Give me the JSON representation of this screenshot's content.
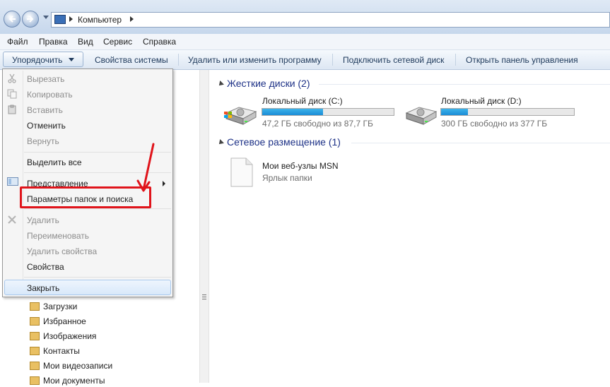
{
  "address": {
    "crumbs": [
      "Компьютер"
    ]
  },
  "menubar": {
    "items": [
      "Файл",
      "Правка",
      "Вид",
      "Сервис",
      "Справка"
    ]
  },
  "command_bar": {
    "organize": "Упорядочить",
    "system_properties": "Свойства системы",
    "uninstall": "Удалить или изменить программу",
    "map_drive": "Подключить сетевой диск",
    "control_panel": "Открыть панель управления"
  },
  "context_menu": {
    "cut": "Вырезать",
    "copy": "Копировать",
    "paste": "Вставить",
    "undo": "Отменить",
    "redo": "Вернуть",
    "select_all": "Выделить все",
    "layout": "Представление",
    "folder_options": "Параметры папок и поиска",
    "delete": "Удалить",
    "rename": "Переименовать",
    "remove_properties": "Удалить свойства",
    "properties": "Свойства",
    "close": "Закрыть"
  },
  "navigation": {
    "items": [
      "Загрузки",
      "Избранное",
      "Изображения",
      "Контакты",
      "Мои видеозаписи",
      "Мои документы"
    ]
  },
  "hard_drives": {
    "header": "Жесткие диски (2)",
    "drives": [
      {
        "name": "Локальный диск (C:)",
        "info": "47,2 ГБ свободно из 87,7 ГБ",
        "used_fraction": 0.46
      },
      {
        "name": "Локальный диск (D:)",
        "info": "300 ГБ свободно из 377 ГБ",
        "used_fraction": 0.2
      }
    ]
  },
  "network": {
    "header": "Сетевое размещение (1)",
    "item_name": "Мои веб-узлы MSN",
    "item_type": "Ярлык папки"
  },
  "colors": {
    "highlight_box": "#e0141b",
    "drive_fill": "#1a8cd6",
    "group_header": "#1e3287"
  }
}
